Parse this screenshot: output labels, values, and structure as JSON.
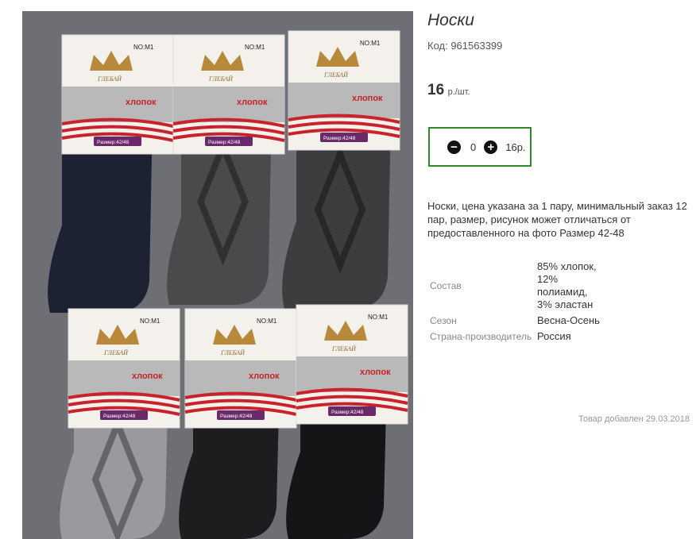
{
  "product": {
    "title": "Носки",
    "code_label": "Код: 961563399",
    "price_value": "16",
    "price_unit": "р./шт.",
    "quantity": "0",
    "sum": "16р.",
    "description": "Носки, цена указана за 1 пару, минимальный заказ 12 пар, размер, рисунок может отличаться от предоставленного на фото Размер 42-48",
    "properties": [
      {
        "key": "Состав",
        "value": "85% хлопок, 12% полиамид, 3% эластан"
      },
      {
        "key": "Сезон",
        "value": "Весна-Осень"
      },
      {
        "key": "Страна-производитель",
        "value": "Россия"
      }
    ],
    "added": "Товар добавлен 29.03.2018"
  },
  "photo": {
    "label_no": "NO:M1",
    "label_brand": "ГЛЕБАЙ",
    "label_material": "хлопок",
    "label_size": "Размер:42/48",
    "sock_colors": [
      "#1c2231",
      "#4a4a4c",
      "#3d3d3f",
      "#9a9a9e",
      "#1d1d20",
      "#151517"
    ]
  },
  "icons": {
    "minus": "minus-circle-icon",
    "plus": "plus-circle-icon"
  }
}
